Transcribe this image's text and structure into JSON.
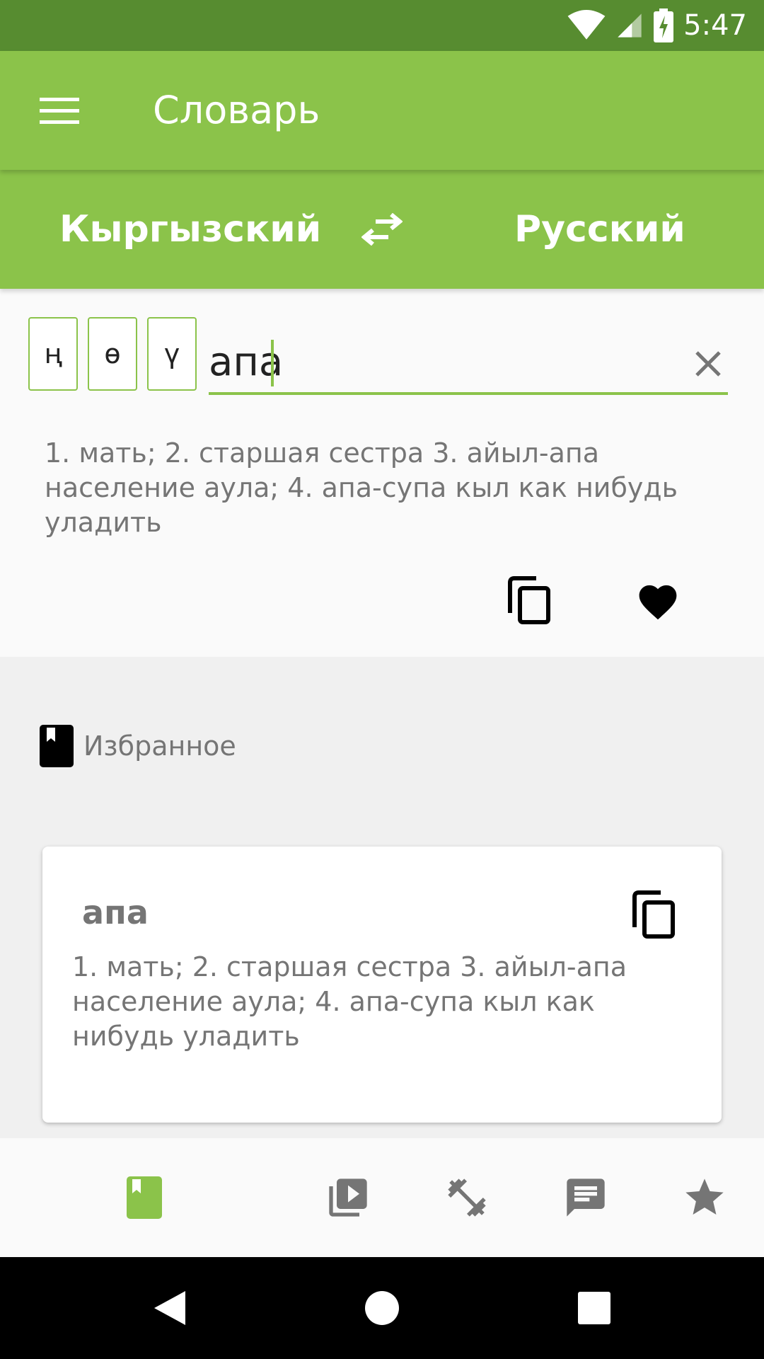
{
  "status_bar": {
    "time": "5:47"
  },
  "app_bar": {
    "title": "Словарь"
  },
  "languages": {
    "source": "Кыргызский",
    "target": "Русский"
  },
  "special_chars": [
    "ң",
    "ө",
    "ү"
  ],
  "search": {
    "value": "апа",
    "placeholder": ""
  },
  "translation": "1. мать; 2. старшая сестра 3. айыл-апа население аула; 4. апа-супа кыл как нибудь уладить",
  "favorites": {
    "title": "Избранное",
    "items": [
      {
        "word": "апа",
        "translation": "1. мать; 2. старшая сестра 3. айыл-апа население аула; 4. апа-супа кыл как нибудь уладить"
      }
    ]
  },
  "bottom_nav": {
    "items": [
      {
        "icon": "book-icon",
        "active": true
      },
      {
        "icon": "video-library-icon",
        "active": false
      },
      {
        "icon": "dumbbell-icon",
        "active": false
      },
      {
        "icon": "chat-icon",
        "active": false
      },
      {
        "icon": "star-icon",
        "active": false
      }
    ]
  },
  "colors": {
    "primary": "#8bc34a",
    "primary_dark": "#578c30",
    "text_secondary": "#757575",
    "icon_inactive": "#757575"
  }
}
